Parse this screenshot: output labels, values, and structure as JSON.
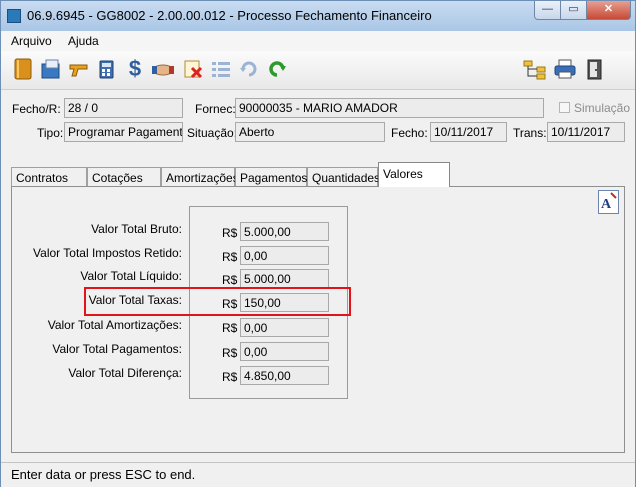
{
  "window": {
    "title": "06.9.6945 - GG8002 - 2.00.00.012 - Processo Fechamento Financeiro",
    "controls": {
      "minimize": "—",
      "maximize": "▭",
      "close": "✕"
    }
  },
  "menu": {
    "items": [
      "Arquivo",
      "Ajuda"
    ]
  },
  "toolbar": {
    "left_icons": [
      "book-icon",
      "save-folder-icon",
      "pistol-icon",
      "calculator-icon",
      "dollar-icon",
      "handshake-icon",
      "delete-document-icon",
      "list-icon",
      "refresh-icon",
      "redo-arrow-icon"
    ],
    "right_icons": [
      "tree-icon",
      "print-icon",
      "exit-door-icon"
    ]
  },
  "header": {
    "fecho_r_label": "Fecho/R:",
    "fecho_r_value": "28 / 0",
    "fornec_label": "Fornec:",
    "fornec_value": "90000035 - MARIO AMADOR",
    "simulacao_label": "Simulação",
    "tipo_label": "Tipo:",
    "tipo_value": "Programar Pagamento",
    "situacao_label": "Situação:",
    "situacao_value": "Aberto",
    "fecho_label": "Fecho:",
    "fecho_value": "10/11/2017",
    "trans_label": "Trans:",
    "trans_value": "10/11/2017"
  },
  "tabs": [
    {
      "label": "Contratos",
      "active": false
    },
    {
      "label": "Cotações",
      "active": false
    },
    {
      "label": "Amortizações",
      "active": false
    },
    {
      "label": "Pagamentos",
      "active": false
    },
    {
      "label": "Quantidades",
      "active": false
    },
    {
      "label": "Valores",
      "active": true
    }
  ],
  "valores": {
    "currency": "R$",
    "rows": [
      {
        "label": "Valor Total Bruto:",
        "value": "5.000,00"
      },
      {
        "label": "Valor Total Impostos Retido:",
        "value": "0,00"
      },
      {
        "label": "Valor Total Líquido:",
        "value": "5.000,00"
      },
      {
        "label": "Valor Total Taxas:",
        "value": "150,00"
      },
      {
        "label": "Valor Total Amortizações:",
        "value": "0,00"
      },
      {
        "label": "Valor Total Pagamentos:",
        "value": "0,00"
      },
      {
        "label": "Valor Total Diferença:",
        "value": "4.850,00"
      }
    ],
    "highlighted_row": "Valor Total Taxas:",
    "highlight_color": "#e0141a"
  },
  "status": {
    "text": "Enter data or press ESC to end."
  }
}
